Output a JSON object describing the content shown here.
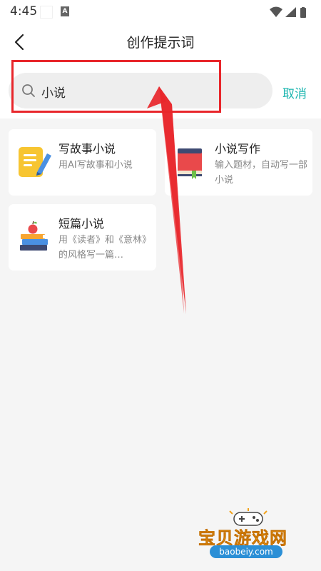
{
  "status_bar": {
    "time": "4:45",
    "notification_icon_label": "A"
  },
  "header": {
    "title": "创作提示词"
  },
  "search": {
    "value": "小说",
    "cancel_label": "取消"
  },
  "cards": [
    {
      "title": "写故事小说",
      "desc": "用AI写故事和小说",
      "icon": "notepad-pencil-icon"
    },
    {
      "title": "小说写作",
      "desc": "输入题材，自动写一部小说",
      "icon": "red-book-icon"
    },
    {
      "title": "短篇小说",
      "desc": "用《读者》和《意林》的风格写一篇…",
      "icon": "books-apple-icon"
    }
  ],
  "watermark": {
    "title": "宝贝游戏网",
    "url": "baobeiy.com"
  },
  "colors": {
    "accent": "#17b4ae",
    "highlight": "#e8262b"
  }
}
